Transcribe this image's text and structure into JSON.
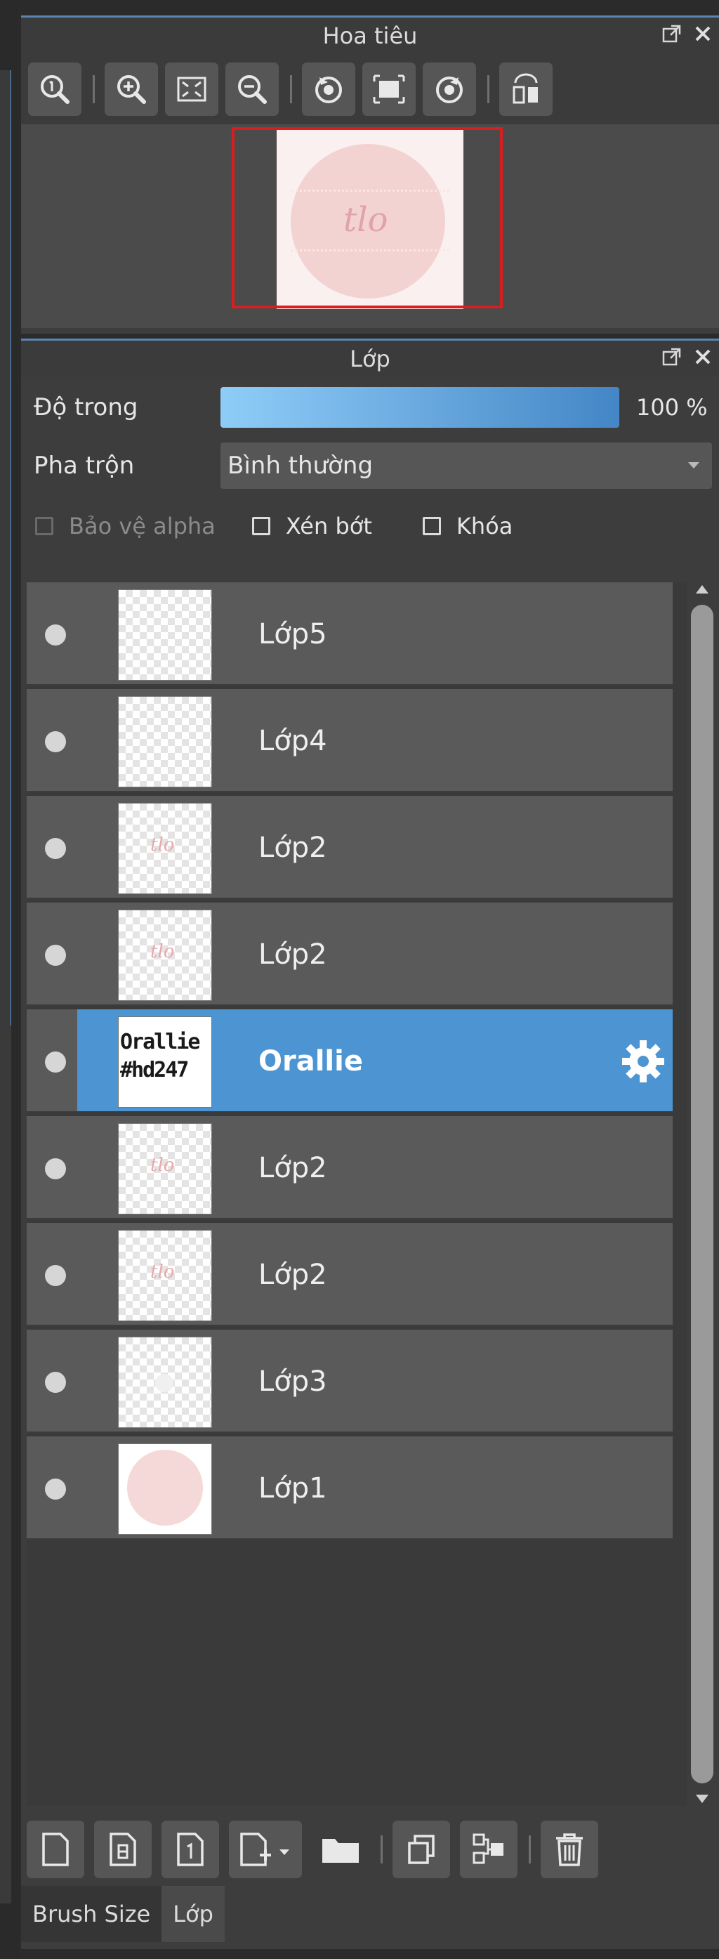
{
  "navigator": {
    "title": "Hoa tiêu",
    "controls": [
      "popout-icon",
      "close-icon"
    ],
    "tools": [
      "zoom-reset-icon",
      "zoom-in-icon",
      "fit-screen-icon",
      "zoom-out-icon",
      "rotate-left-icon",
      "actual-size-icon",
      "rotate-right-icon",
      "flip-horizontal-icon"
    ],
    "preview_mark": "tlo"
  },
  "layers": {
    "title": "Lớp",
    "opacity": {
      "label": "Độ trong",
      "value": "100 %",
      "level": 1.0
    },
    "blend": {
      "label": "Pha trộn",
      "value": "Bình thường"
    },
    "checks": [
      {
        "label": "Bảo vệ alpha",
        "checked": false,
        "disabled": true
      },
      {
        "label": "Xén bớt",
        "checked": false,
        "disabled": false
      },
      {
        "label": "Khóa",
        "checked": false,
        "disabled": false
      }
    ],
    "items": [
      {
        "name": "Lớp5",
        "thumb": "empty",
        "selected": false
      },
      {
        "name": "Lớp4",
        "thumb": "empty",
        "selected": false
      },
      {
        "name": "Lớp2",
        "thumb": "mark",
        "selected": false
      },
      {
        "name": "Lớp2",
        "thumb": "mark",
        "selected": false
      },
      {
        "name": "Orallie",
        "thumb": "text",
        "thumb_text": "Orallie #hd247",
        "selected": true
      },
      {
        "name": "Lớp2",
        "thumb": "mark",
        "selected": false
      },
      {
        "name": "Lớp2",
        "thumb": "mark",
        "selected": false
      },
      {
        "name": "Lớp3",
        "thumb": "blob",
        "selected": false
      },
      {
        "name": "Lớp1",
        "thumb": "pink",
        "selected": false
      }
    ],
    "thumb_mark": "tlo",
    "bottom_tools": [
      "new-layer-icon",
      "new-8bit-layer-icon",
      "new-1bit-layer-icon",
      "add-layer-menu-icon",
      "folder-icon",
      "duplicate-layer-icon",
      "merge-down-icon",
      "trash-icon"
    ]
  },
  "tabs": [
    "Brush Size",
    "Lớp"
  ]
}
